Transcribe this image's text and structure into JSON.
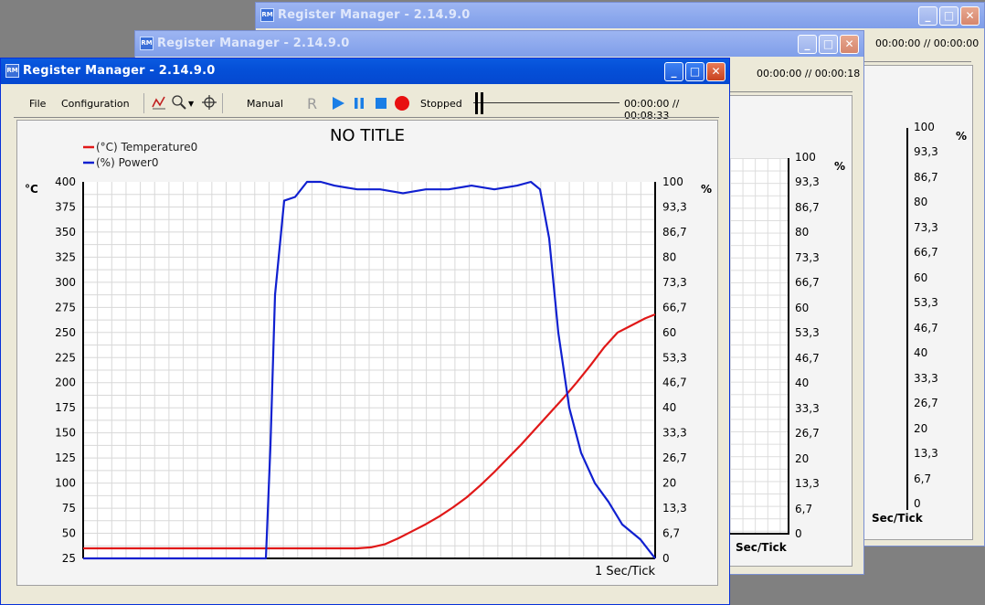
{
  "app": {
    "title": "Register Manager - 2.14.9.0"
  },
  "back_windows": [
    {
      "time": "00:00:00 // 00:00:00",
      "right_ticks": [
        "100",
        "93,3",
        "86,7",
        "80",
        "73,3",
        "66,7",
        "60",
        "53,3",
        "46,7",
        "40",
        "33,3",
        "26,7",
        "20",
        "13,3",
        "6,7",
        "0"
      ],
      "unit": "%",
      "xlabel": "Sec/Tick"
    },
    {
      "time": "00:00:00 // 00:00:18",
      "right_ticks": [
        "100",
        "93,3",
        "86,7",
        "80",
        "73,3",
        "66,7",
        "60",
        "53,3",
        "46,7",
        "40",
        "33,3",
        "26,7",
        "20",
        "13,3",
        "6,7",
        "0"
      ],
      "unit": "%",
      "xlabel": "Sec/Tick"
    }
  ],
  "menu": {
    "file": "File",
    "configuration": "Configuration"
  },
  "toolbar": {
    "manual": "Manual",
    "r": "R",
    "status": "Stopped",
    "time": "00:00:00 // 00:08:33"
  },
  "chart_data": {
    "type": "line",
    "title": "NO TITLE",
    "xlabel": "1 Sec/Tick",
    "y_left": {
      "unit": "°C",
      "ylim": [
        25,
        400
      ],
      "ticks": [
        "400",
        "375",
        "350",
        "325",
        "300",
        "275",
        "250",
        "225",
        "200",
        "175",
        "150",
        "125",
        "100",
        "75",
        "50",
        "25"
      ]
    },
    "y_right": {
      "unit": "%",
      "ylim": [
        0,
        100
      ],
      "ticks": [
        "100",
        "93,3",
        "86,7",
        "80",
        "73,3",
        "66,7",
        "60",
        "53,3",
        "46,7",
        "40",
        "33,3",
        "26,7",
        "20",
        "13,3",
        "6,7",
        "0"
      ]
    },
    "grid": true,
    "legend_position": "top-left",
    "series": [
      {
        "name": "(°C) Temperature0",
        "color": "#e01818",
        "axis": "left",
        "x": [
          0,
          30,
          60,
          90,
          105,
          115,
          125,
          135,
          150,
          165,
          180,
          195,
          210,
          225,
          240,
          255,
          270,
          285,
          300,
          315,
          330,
          345,
          360,
          375,
          390,
          405,
          420,
          435,
          450,
          465,
          480,
          495,
          510,
          525,
          540,
          555,
          570,
          585,
          600,
          615,
          626
        ],
        "y": [
          35,
          35,
          35,
          35,
          35,
          35,
          35,
          35,
          35,
          35,
          35,
          35,
          35,
          35,
          35,
          35,
          35,
          35,
          35,
          36,
          39,
          45,
          52,
          59,
          67,
          76,
          86,
          98,
          111,
          125,
          139,
          154,
          169,
          184,
          200,
          217,
          235,
          250,
          257,
          264,
          268
        ]
      },
      {
        "name": "(%) Power0",
        "color": "#1020d0",
        "axis": "right",
        "x": [
          0,
          40,
          80,
          120,
          160,
          190,
          200,
          205,
          210,
          220,
          232,
          245,
          260,
          275,
          300,
          325,
          350,
          375,
          400,
          425,
          450,
          475,
          490,
          500,
          510,
          520,
          532,
          545,
          560,
          575,
          590,
          610,
          626
        ],
        "y": [
          0,
          0,
          0,
          0,
          0,
          0,
          0,
          30,
          70,
          95,
          96,
          100,
          100,
          99,
          98,
          98,
          97,
          98,
          98,
          99,
          98,
          99,
          100,
          98,
          85,
          60,
          40,
          28,
          20,
          15,
          9,
          5,
          0
        ]
      }
    ]
  }
}
